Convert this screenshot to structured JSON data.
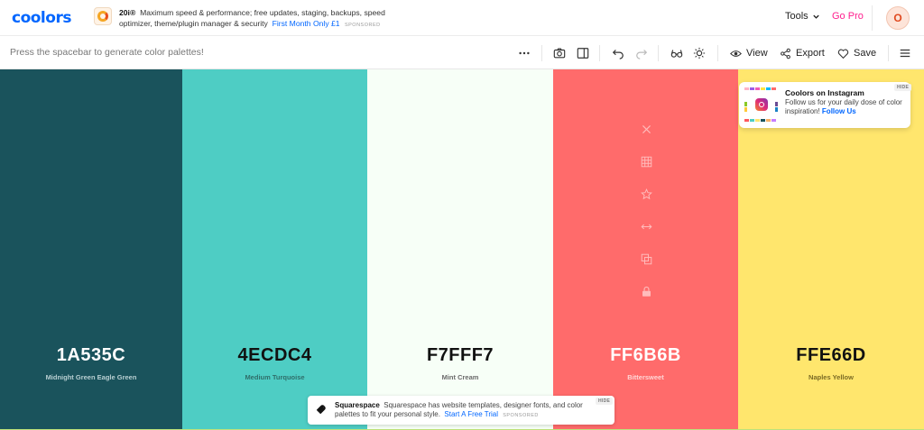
{
  "header": {
    "logo": "coolors",
    "ad": {
      "brand": "20i®",
      "text": "Maximum speed & performance; free updates, staging, backups, speed optimizer, theme/plugin manager & security",
      "cta": "First Month Only £1",
      "sponsored": "SPONSORED"
    },
    "tools_label": "Tools",
    "gopro_label": "Go Pro",
    "avatar_initial": "O"
  },
  "toolbar": {
    "hint": "Press the spacebar to generate color palettes!",
    "view_label": "View",
    "export_label": "Export",
    "save_label": "Save"
  },
  "palette": [
    {
      "hex": "1A535C",
      "name": "Midnight Green Eagle Green",
      "color": "#1A535C",
      "text_color": "#ffffff",
      "name_color": "#b8cfd2"
    },
    {
      "hex": "4ECDC4",
      "name": "Medium Turquoise",
      "color": "#4ECDC4",
      "text_color": "#111111",
      "name_color": "#2f6e6a"
    },
    {
      "hex": "F7FFF7",
      "name": "Mint Cream",
      "color": "#F7FFF7",
      "text_color": "#111111",
      "name_color": "#6b6b6b"
    },
    {
      "hex": "FF6B6B",
      "name": "Bittersweet",
      "color": "#FF6B6B",
      "text_color": "#ffffff",
      "name_color": "#ffd6d6"
    },
    {
      "hex": "FFE66D",
      "name": "Naples Yellow",
      "color": "#FFE66D",
      "text_color": "#111111",
      "name_color": "#7a6a24"
    }
  ],
  "swatch_tools": [
    "close-icon",
    "grid-icon",
    "star-icon",
    "drag-icon",
    "copy-icon",
    "lock-icon"
  ],
  "instagram_card": {
    "title": "Coolors on Instagram",
    "body": "Follow us for your daily dose of color inspiration!",
    "cta": "Follow Us",
    "hide": "HIDE"
  },
  "squarespace_ad": {
    "brand": "Squarespace",
    "text": "Squarespace has website templates, designer fonts, and color palettes to fit your personal style.",
    "cta": "Start A Free Trial",
    "sponsored": "SPONSORED",
    "hide": "HIDE"
  }
}
